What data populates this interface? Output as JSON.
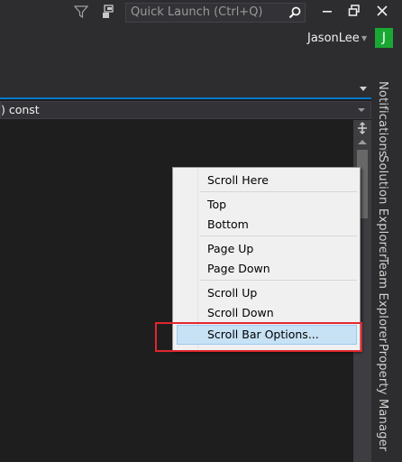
{
  "titlebar": {
    "quick_launch_placeholder": "Quick Launch (Ctrl+Q)",
    "user_name": "JasonLee",
    "avatar_initial": "J",
    "avatar_color": "#1aa834"
  },
  "editor": {
    "nav_combo_text": ") const",
    "accent_color": "#007acc"
  },
  "side_tabs": [
    "Notifications",
    "Solution Explorer",
    "Team Explorer",
    "Property Manager"
  ],
  "context_menu": {
    "items": [
      "Scroll Here",
      "Top",
      "Bottom",
      "Page Up",
      "Page Down",
      "Scroll Up",
      "Scroll Down",
      "Scroll Bar Options..."
    ],
    "highlighted": "Scroll Bar Options..."
  },
  "icons": [
    "filter-icon",
    "feedback-icon",
    "search-icon",
    "minimize-icon",
    "restore-icon",
    "close-icon",
    "split-handle-icon"
  ]
}
